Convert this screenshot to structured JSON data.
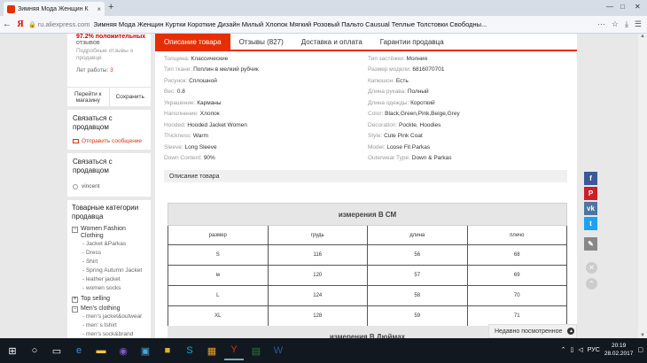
{
  "browser": {
    "tab_title": "Зимняя Мода Женщин К",
    "tab_close": "×",
    "new_tab": "+",
    "url_domain": "ru.aliexpress.com",
    "url_page_title": "Зимняя Мода Женщин Куртки Короткие Дизайн Милый Хлопок Мягкий Розовый Пальто Causual Теплые Толстовки Свободны...",
    "nav_back": "←",
    "nav_brand": "Я",
    "lock": "🔒",
    "icons": [
      "⋯",
      "☆",
      "⤓",
      "☰"
    ],
    "window_controls": [
      "—",
      "□",
      "✕"
    ]
  },
  "sidebar": {
    "positive_pct": "97.2% положительных",
    "positive_lbl": "отзывов",
    "subscribe_text": "Подробные отзывы о продавце",
    "years_label": "Лет работы: ",
    "years_value": "3",
    "visit_store": "Перейти к магазину",
    "save": "Сохранить",
    "contact_title": "Связаться с продавцом",
    "send_message": "Отправить сообщение",
    "contact_title2": "Связаться с продавцом",
    "member_name": "vincent",
    "categories_title": "Товарные категории продавца",
    "categories": [
      {
        "toggle": "−",
        "label": "Women Fashion Clothing",
        "subs": [
          "- Jacket &Parkas",
          "- Dress",
          "- Shirt",
          "- Spring Autumn Jacket",
          "- leather jacket",
          "- women socks"
        ]
      },
      {
        "toggle": "+",
        "label": "Top selling",
        "subs": []
      },
      {
        "toggle": "−",
        "label": "Men's clothing",
        "subs": [
          "- men's jacket&outwear",
          "- men' s tshirt",
          "- men's sock&brand socks"
        ]
      }
    ]
  },
  "main": {
    "tabs": [
      "Описание товара",
      "Отзывы (827)",
      "Доставка и оплата",
      "Гарантии продавца"
    ],
    "properties": [
      [
        {
          "k": "Толщина: ",
          "v": "Классические"
        },
        {
          "k": "Тип застёжки: ",
          "v": "Молния"
        }
      ],
      [
        {
          "k": "Тип ткани: ",
          "v": "Поплин в мелкий рубчик"
        },
        {
          "k": "Размер модели: ",
          "v": "6816070701"
        }
      ],
      [
        {
          "k": "Рисунок: ",
          "v": "Сплошной"
        },
        {
          "k": "Капюшон: ",
          "v": "Есть"
        }
      ],
      [
        {
          "k": "Вес: ",
          "v": "0.8"
        },
        {
          "k": "Длина рукава: ",
          "v": "Полный"
        }
      ],
      [
        {
          "k": "Украшение: ",
          "v": "Карманы"
        },
        {
          "k": "Длина одежды: ",
          "v": "Короткий"
        }
      ],
      [
        {
          "k": "Наполнение: ",
          "v": "Хлопок"
        },
        {
          "k": "Color: ",
          "v": "Black,Green,Pink,Beige,Grey"
        }
      ],
      [
        {
          "k": "Hooded: ",
          "v": "Hooded Jacket Women"
        },
        {
          "k": "Decoration: ",
          "v": "Pockte, Hoodies"
        }
      ],
      [
        {
          "k": "Thickness: ",
          "v": "Warm"
        },
        {
          "k": "Style: ",
          "v": "Cute Pink Coat"
        }
      ],
      [
        {
          "k": "Sleeve: ",
          "v": "Long Sleeve"
        },
        {
          "k": "Model: ",
          "v": "Loose Fit Parkas"
        }
      ],
      [
        {
          "k": "Down Content: ",
          "v": "90%"
        },
        {
          "k": "Outerwear Type: ",
          "v": "Down & Parkas"
        }
      ]
    ],
    "desc_bar": "Описание товара",
    "size_table_title": "измерения В СМ",
    "size_headers": [
      "размер",
      "грудь",
      "длина",
      "плечо"
    ],
    "size_rows": [
      [
        "S",
        "116",
        "56",
        "68"
      ],
      [
        "м",
        "120",
        "57",
        "69"
      ],
      [
        "L",
        "124",
        "58",
        "70"
      ],
      [
        "XL",
        "128",
        "59",
        "71"
      ]
    ],
    "size_table2_title": "измерения В Дюймах"
  },
  "recently_viewed": "Недавно посмотренное",
  "share": {
    "facebook": {
      "glyph": "f",
      "color": "#3b5998"
    },
    "pinterest": {
      "glyph": "P",
      "color": "#cb2027"
    },
    "vk": {
      "glyph": "vk",
      "color": "#4c75a3"
    },
    "twitter": {
      "glyph": "t",
      "color": "#1da1f2"
    },
    "edit": {
      "glyph": "✎",
      "color": "#888888"
    }
  },
  "taskbar": {
    "lang": "РУС",
    "time": "20:19",
    "date": "28.02.2017"
  },
  "colors": {
    "accent": "#e62e04"
  }
}
